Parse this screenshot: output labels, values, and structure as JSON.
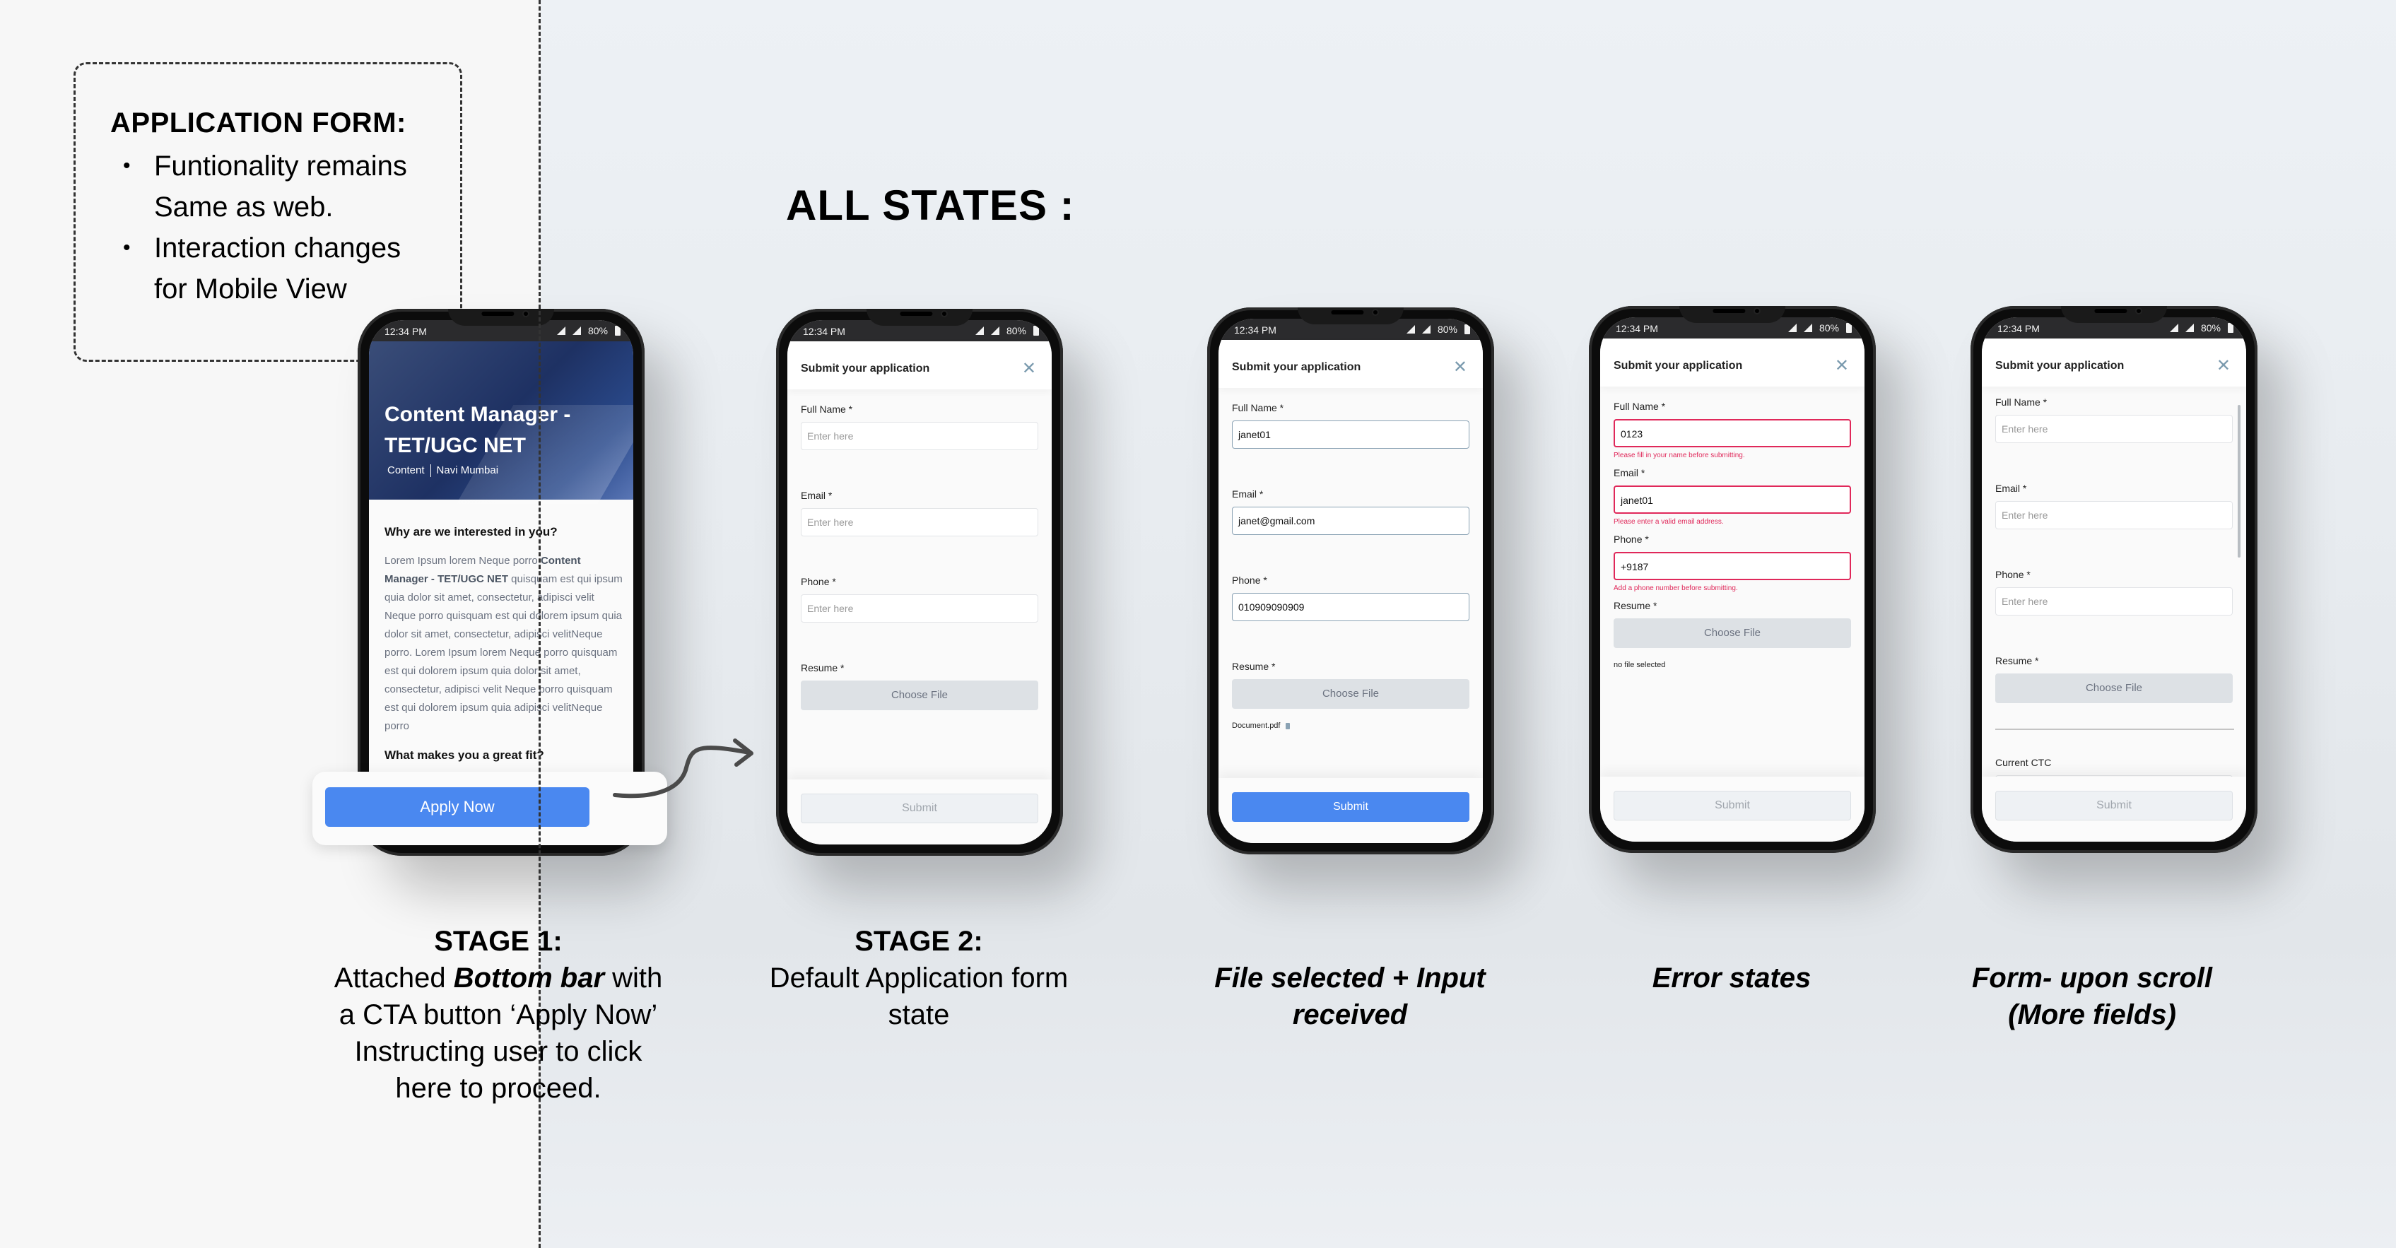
{
  "note": {
    "title": "APPLICATION FORM:",
    "bullets": [
      "Funtionality remains Same as web.",
      "Interaction changes for Mobile View"
    ]
  },
  "heading": "ALL STATES :",
  "status_bar": {
    "time": "12:34 PM",
    "battery": "80%"
  },
  "stage1": {
    "job_title": "Content Manager - TET/UGC NET",
    "category": "Content",
    "location": "Navi Mumbai",
    "section1_heading": "Why are we interested in you?",
    "section1_text_pre": "Lorem Ipsum lorem Neque porro ",
    "section1_text_bold": "Content Manager - TET/UGC NET",
    "section1_text_post": " quisquam est qui ipsum quia dolor sit amet, consectetur, adipisci velit Neque porro quisquam est qui dolorem ipsum quia dolor sit amet, consectetur, adipisci velitNeque porro. Lorem Ipsum lorem Neque porro quisquam est qui dolorem ipsum quia dolor sit amet, consectetur, adipisci velit Neque porro quisquam est qui dolorem ipsum quia adipisci velitNeque porro",
    "section2_heading": "What makes you a great fit?",
    "cta_label": "Apply Now"
  },
  "form": {
    "title": "Submit your application",
    "placeholder": "Enter here",
    "labels": {
      "name": "Full Name *",
      "email": "Email *",
      "phone": "Phone *",
      "resume": "Resume *",
      "ctc": "Current CTC"
    },
    "choose_file": "Choose File",
    "submit": "Submit"
  },
  "states": {
    "default": {
      "name": "",
      "email": "",
      "phone": ""
    },
    "filled": {
      "name": "janet01",
      "email": "janet@gmail.com",
      "phone": "010909090909",
      "file": "Document.pdf"
    },
    "error": {
      "name": "0123",
      "email": "janet01",
      "phone": "+9187",
      "name_error": "Please fill in your name before submitting.",
      "email_error": "Please enter a valid email address.",
      "phone_error": "Add a phone number before submitting.",
      "file": "no file selected"
    }
  },
  "captions": {
    "stage1_title": "STAGE 1:",
    "stage1_pre": "Attached ",
    "stage1_em": "Bottom bar",
    "stage1_post": " with a CTA button ‘Apply Now’ Instructing user to click here to proceed.",
    "stage2_title": "STAGE 2:",
    "stage2_text": "Default Application form state",
    "state3": "File selected + Input received",
    "state4": "Error states",
    "state5": "Form- upon scroll (More fields)"
  },
  "colors": {
    "accent": "#4a88f0",
    "error": "#e0285a",
    "hero": "#1e3163"
  }
}
